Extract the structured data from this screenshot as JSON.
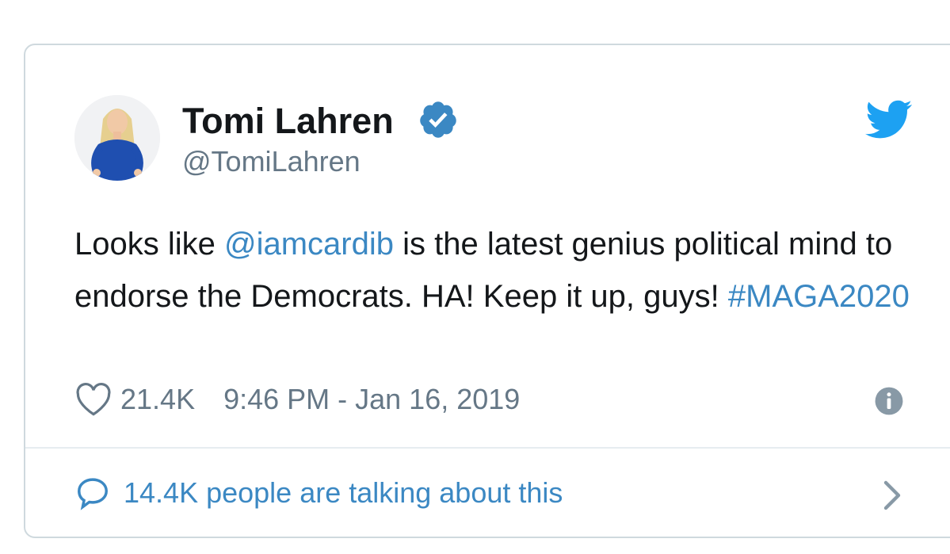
{
  "tweet": {
    "display_name": "Tomi Lahren",
    "handle": "@TomiLahren",
    "verified": true,
    "text": {
      "part1": "Looks like ",
      "mention": "@iamcardib",
      "part2": " is the latest genius political mind to endorse the Democrats. HA! Keep it up, guys! ",
      "hashtag": "#MAGA2020"
    },
    "likes": "21.4K",
    "timestamp": "9:46 PM - Jan 16, 2019",
    "talking": "14.4K people are talking about this"
  },
  "icons": {
    "bird": "twitter-bird-icon",
    "verified": "verified-badge-icon",
    "like": "heart-icon",
    "info": "info-icon",
    "reply": "speech-bubble-icon",
    "more": "chevron-right-icon"
  },
  "colors": {
    "link": "#3b88c3",
    "twitter_blue": "#1da1f2",
    "text": "#14171a",
    "muted": "#657786",
    "border": "#cfd9de"
  }
}
